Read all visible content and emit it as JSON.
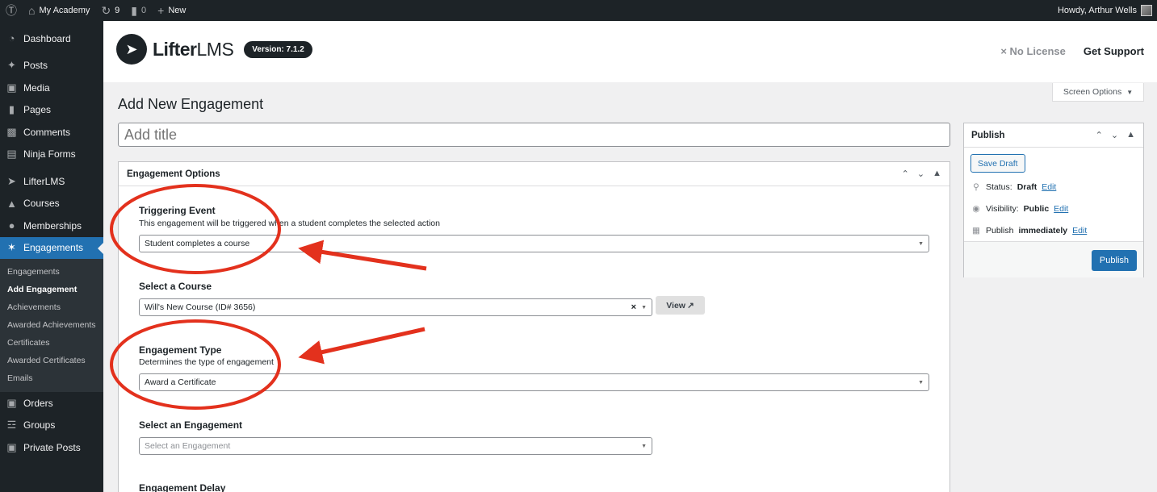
{
  "adminbar": {
    "site_name": "My Academy",
    "updates_count": "9",
    "comments_count": "0",
    "new_label": "New",
    "greeting": "Howdy, Arthur Wells"
  },
  "sidebar": {
    "top_items": [
      {
        "label": "Dashboard",
        "icon": "dashboard-icon"
      },
      {
        "label": "Posts",
        "icon": "pin-icon"
      },
      {
        "label": "Media",
        "icon": "media-icon"
      },
      {
        "label": "Pages",
        "icon": "pages-icon"
      },
      {
        "label": "Comments",
        "icon": "comment-icon"
      },
      {
        "label": "Ninja Forms",
        "icon": "form-icon"
      },
      {
        "label": "LifterLMS",
        "icon": "rocket-icon"
      },
      {
        "label": "Courses",
        "icon": "graduation-cap-icon"
      },
      {
        "label": "Memberships",
        "icon": "groups-icon"
      },
      {
        "label": "Engagements",
        "icon": "award-icon"
      }
    ],
    "submenu": [
      "Engagements",
      "Add Engagement",
      "Achievements",
      "Awarded Achievements",
      "Certificates",
      "Awarded Certificates",
      "Emails"
    ],
    "bottom_items": [
      {
        "label": "Orders",
        "icon": "cart-icon"
      },
      {
        "label": "Groups",
        "icon": "hierarchy-icon"
      },
      {
        "label": "Private Posts",
        "icon": "lock-icon"
      }
    ]
  },
  "header": {
    "brand_bold": "Lifter",
    "brand_light": "LMS",
    "version": "Version: 7.1.2",
    "no_license": "No License",
    "support": "Get Support"
  },
  "screen_options": "Screen Options",
  "page_title": "Add New Engagement",
  "title_placeholder": "Add title",
  "engagement_options": {
    "heading": "Engagement Options",
    "triggering_event": {
      "label": "Triggering Event",
      "description": "This engagement will be triggered when a student completes the selected action",
      "value": "Student completes a course"
    },
    "select_course": {
      "label": "Select a Course",
      "value": "Will's New Course (ID# 3656)",
      "view_label": "View"
    },
    "engagement_type": {
      "label": "Engagement Type",
      "description": "Determines the type of engagement",
      "value": "Award a Certificate"
    },
    "select_engagement": {
      "label": "Select an Engagement",
      "placeholder": "Select an Engagement"
    },
    "engagement_delay": {
      "label": "Engagement Delay"
    }
  },
  "publish": {
    "heading": "Publish",
    "save_draft": "Save Draft",
    "status_label": "Status:",
    "status_value": "Draft",
    "visibility_label": "Visibility:",
    "visibility_value": "Public",
    "publish_label": "Publish",
    "publish_value": "immediately",
    "edit_label": "Edit",
    "publish_button": "Publish"
  },
  "colors": {
    "admin_dark": "#1d2327",
    "accent_blue": "#2271b1",
    "annotation_red": "#e3311d"
  }
}
